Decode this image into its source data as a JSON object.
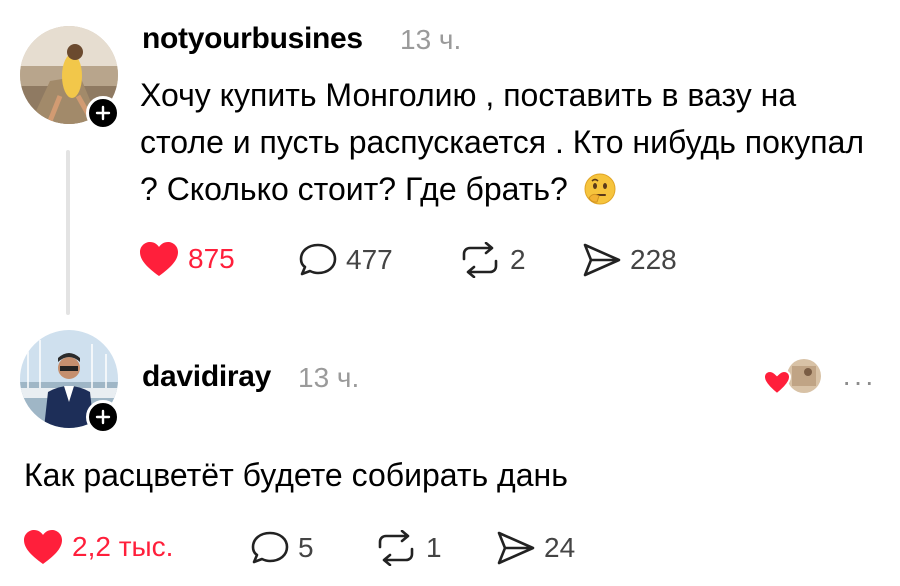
{
  "post": {
    "username": "notyourbusines",
    "time": "13 ч.",
    "text": "Хочу купить Монголию , поставить в вазу на столе и пусть распускается . Кто нибудь покупал ? Сколько стоит? Где брать?",
    "emoji": "thinking-face-icon",
    "likes": "875",
    "comments": "477",
    "reposts": "2",
    "shares": "228"
  },
  "reply": {
    "username": "davidiray",
    "time": "13 ч.",
    "text": "Как расцветёт будете собирать дань",
    "likes": "2,2 тыс.",
    "comments": "5",
    "reposts": "1",
    "shares": "24",
    "more": "···"
  },
  "colors": {
    "like": "#ff1f3b",
    "text": "#000000",
    "muted": "#9a9a9a",
    "thread_line": "#e3e3e3"
  }
}
